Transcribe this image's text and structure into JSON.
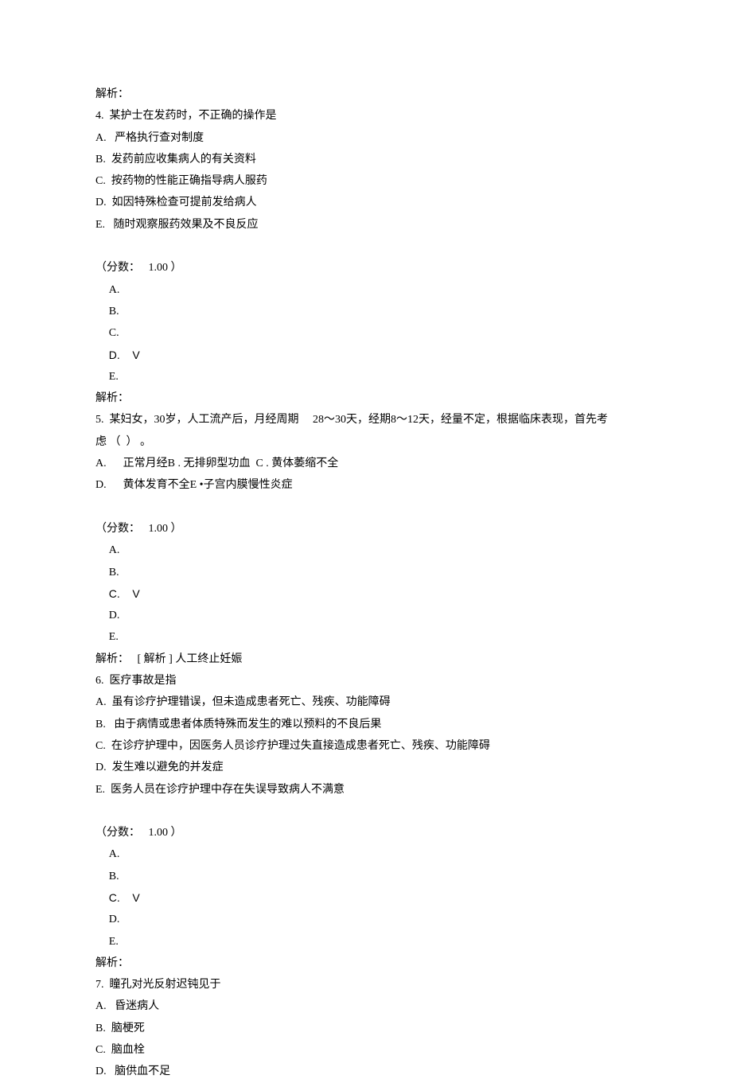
{
  "q4": {
    "analysis_label": "解析：",
    "stem": "4.  某护士在发药时，不正确的操作是",
    "opts": {
      "a": "A.   严格执行查对制度",
      "b": "B.  发药前应收集病人的有关资料",
      "c": "C.  按药物的性能正确指导病人服药",
      "d": "D.  如因特殊检查可提前发给病人",
      "e": "E.   随时观察服药效果及不良反应"
    },
    "score": "（分数：   1.00 ）",
    "ans": {
      "a": "A.",
      "b": "B.",
      "c": "C.",
      "d": "D.    V",
      "e": "E."
    },
    "post_analysis": "解析："
  },
  "q5": {
    "stem1": "5.  某妇女，30岁，人工流产后，月经周期     28～30天，经期8～12天，经量不定，根据临床表现，首先考",
    "stem2": "虑 （  ） 。",
    "optline1": "A.      正常月经B . 无排卵型功血  C . 黄体萎缩不全",
    "optline2": "D.      黄体发育不全E •子宫内膜慢性炎症",
    "score": "（分数：   1.00 ）",
    "ans": {
      "a": "A.",
      "b": "B.",
      "c": "C.    V",
      "d": "D.",
      "e": "E."
    },
    "post_analysis": "解析：   [ 解析 ] 人工终止妊娠"
  },
  "q6": {
    "stem": "6.  医疗事故是指",
    "opts": {
      "a": "A.  虽有诊疗护理错误，但未造成患者死亡、残疾、功能障碍",
      "b": "B.   由于病情或患者体质特殊而发生的难以预料的不良后果",
      "c": "C.  在诊疗护理中，因医务人员诊疗护理过失直接造成患者死亡、残疾、功能障碍",
      "d": "D.  发生难以避免的并发症",
      "e": "E.  医务人员在诊疗护理中存在失误导致病人不满意"
    },
    "score": "（分数：   1.00 ）",
    "ans": {
      "a": "A.",
      "b": "B.",
      "c": "C.    V",
      "d": "D.",
      "e": "E."
    },
    "post_analysis": "解析："
  },
  "q7": {
    "stem": "7.  瞳孔对光反射迟钝见于",
    "opts": {
      "a": "A.   昏迷病人",
      "b": "B.  脑梗死",
      "c": "C.  脑血栓",
      "d": "D.   脑供血不足"
    }
  }
}
